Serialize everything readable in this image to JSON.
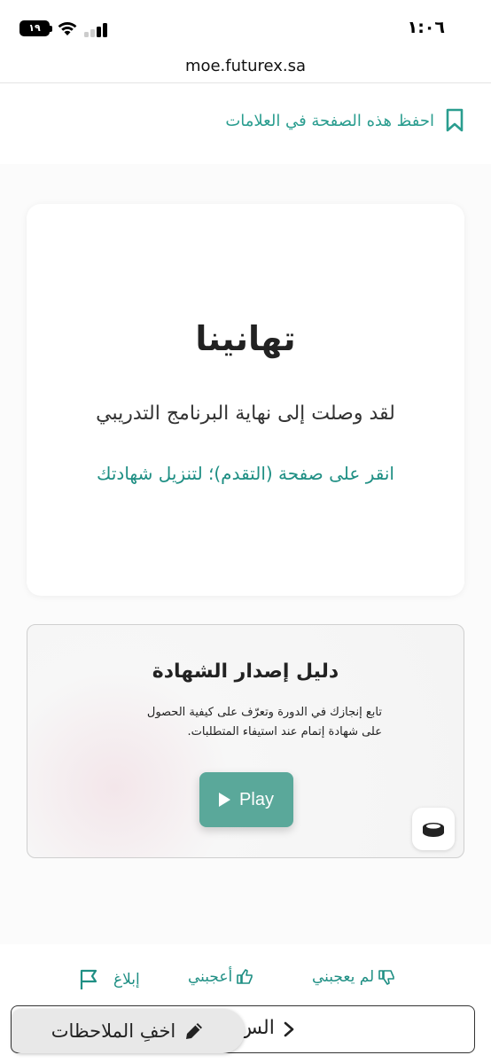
{
  "status_bar": {
    "time": "١:٠٦",
    "battery": "١٩"
  },
  "browser": {
    "url": "moe.futurex.sa"
  },
  "bookmark": {
    "label": "احفظ هذه الصفحة في العلامات",
    "icon": "bookmark-icon"
  },
  "congrats": {
    "title": "تهانينا",
    "subtitle": "لقد وصلت إلى نهاية البرنامج التدريبي",
    "link_text": "انقر على صفحة (التقدم)؛ لتنزيل شهادتك"
  },
  "video": {
    "title": "دليل إصدار الشهادة",
    "description_line1": "تابع إنجازك في الدورة وتعرّف على كيفية الحصول",
    "description_line2": "على شهادة إتمام عند استيفاء المتطلبات.",
    "play_label": "Play",
    "play_icon": "play-icon",
    "corner_icon": "mute-icon"
  },
  "feedback": {
    "dislike_label": "لم يعجبني",
    "like_label": "أعجبني",
    "report_label": "إبلاغ"
  },
  "bottom_nav": {
    "prev_label": "الس",
    "notes_label": "اخفِ الملاحظات"
  },
  "colors": {
    "accent": "#2a9d8f",
    "play_button": "#5aa89a"
  }
}
